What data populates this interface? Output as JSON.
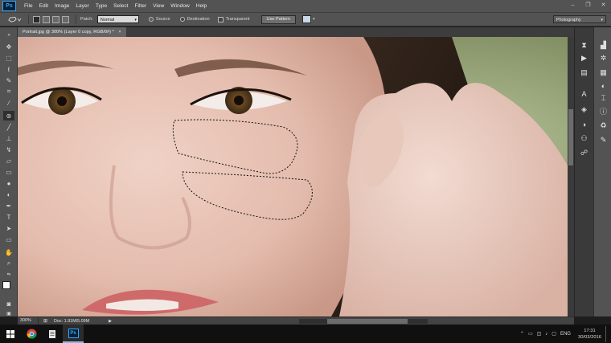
{
  "app": {
    "logo_text": "Ps"
  },
  "menubar": {
    "items": [
      "File",
      "Edit",
      "Image",
      "Layer",
      "Type",
      "Select",
      "Filter",
      "View",
      "Window",
      "Help"
    ],
    "window_controls": [
      "–",
      "❐",
      "✕"
    ]
  },
  "options_bar": {
    "patch_label": "Patch:",
    "patch_mode": "Normal",
    "source_label": "Source",
    "destination_label": "Destination",
    "transparent_label": "Transparent",
    "use_pattern_label": "Use Pattern",
    "workspace": "Photography",
    "selected_radio": "Source"
  },
  "document": {
    "tab_title": "Portrait.jpg @ 300% (Layer 0 copy, RGB/8#) *",
    "tab_close": "×"
  },
  "statusbar": {
    "zoom": "300%",
    "doc_info": "Doc: 1.91M/5.09M"
  },
  "taskbar": {
    "language": "ENG",
    "time": "17:31",
    "date": "30/03/2016"
  },
  "colors": {
    "ui_dark": "#535353",
    "ps_blue": "#31a8ff",
    "foreground_swatch": "#ffffff",
    "background_swatch": "#ffffff"
  }
}
